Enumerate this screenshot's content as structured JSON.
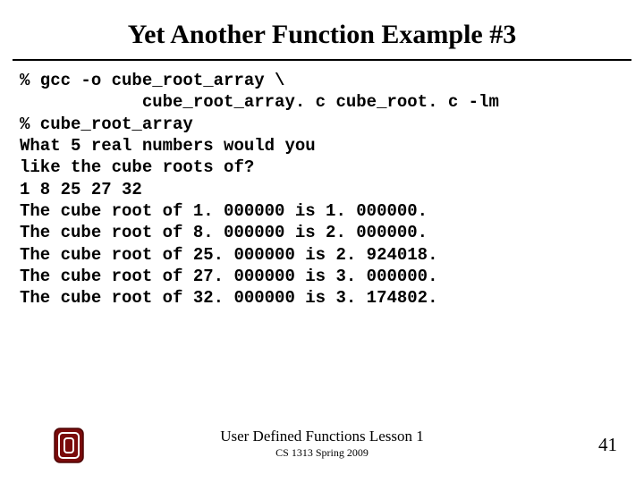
{
  "title": "Yet Another Function Example #3",
  "terminal": "% gcc -o cube_root_array \\\n            cube_root_array. c cube_root. c -lm\n% cube_root_array\nWhat 5 real numbers would you\nlike the cube roots of?\n1 8 25 27 32\nThe cube root of 1. 000000 is 1. 000000.\nThe cube root of 8. 000000 is 2. 000000.\nThe cube root of 25. 000000 is 2. 924018.\nThe cube root of 27. 000000 is 3. 000000.\nThe cube root of 32. 000000 is 3. 174802.",
  "footer": {
    "line1": "User Defined Functions Lesson 1",
    "line2": "CS 1313 Spring 2009"
  },
  "page": "41"
}
